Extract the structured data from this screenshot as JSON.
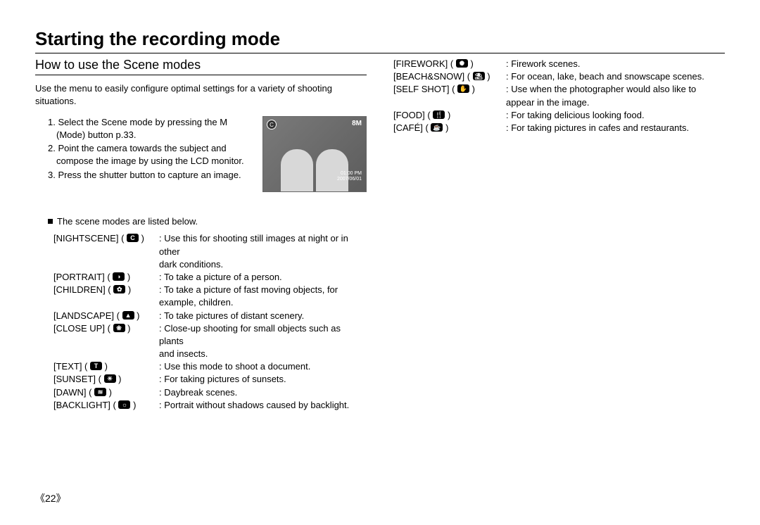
{
  "title": "Starting the recording mode",
  "subtitle": "How to use the Scene modes",
  "intro": "Use the menu to easily configure optimal settings for a variety of shooting situations.",
  "steps": {
    "s1": "1. Select the Scene mode by pressing the M (Mode) button p.33.",
    "s2": "2. Point the camera towards the subject and compose the image by using the LCD monitor.",
    "s3": "3. Press the shutter button to capture an image."
  },
  "lcd": {
    "badge": "C",
    "quality": "8M",
    "time": "01:00 PM",
    "date": "2007/06/01"
  },
  "listed_heading": "The scene modes are listed below.",
  "modes_left": [
    {
      "label": "[NIGHTSCENE]",
      "glyph": "C",
      "desc": "Use this for shooting still images at night or in other",
      "cont": "dark conditions."
    },
    {
      "label": "[PORTRAIT]",
      "glyph": "◑",
      "desc": "To take a picture of a person."
    },
    {
      "label": "[CHILDREN]",
      "glyph": "✿",
      "desc": "To take a picture of fast moving objects, for",
      "cont": "example, children."
    },
    {
      "label": "[LANDSCAPE]",
      "glyph": "▲",
      "desc": "To take pictures of distant scenery."
    },
    {
      "label": "[CLOSE UP]",
      "glyph": "❀",
      "desc": "Close-up shooting for small objects such as plants",
      "cont": "and insects."
    },
    {
      "label": "[TEXT]",
      "glyph": "T",
      "desc": "Use this mode to shoot a document."
    },
    {
      "label": "[SUNSET]",
      "glyph": "☀",
      "desc": "For taking pictures of sunsets."
    },
    {
      "label": "[DAWN]",
      "glyph": "≋",
      "desc": "Daybreak scenes."
    },
    {
      "label": "[BACKLIGHT]",
      "glyph": "☼",
      "desc": "Portrait without shadows caused by backlight."
    }
  ],
  "modes_right": [
    {
      "label": "[FIREWORK]",
      "glyph": "✺",
      "desc": "Firework scenes."
    },
    {
      "label": "[BEACH&SNOW]",
      "glyph": "⛱",
      "desc": "For ocean, lake, beach and snowscape scenes."
    },
    {
      "label": "[SELF SHOT]",
      "glyph": "✋",
      "desc": "Use when the photographer would also like to",
      "cont": "appear in the image."
    },
    {
      "label": "[FOOD]",
      "glyph": "🍴",
      "desc": "For taking delicious looking food."
    },
    {
      "label": "[CAFÉ]",
      "glyph": "☕",
      "desc": "For taking pictures in cafes and restaurants."
    }
  ],
  "page_number": "《22》"
}
